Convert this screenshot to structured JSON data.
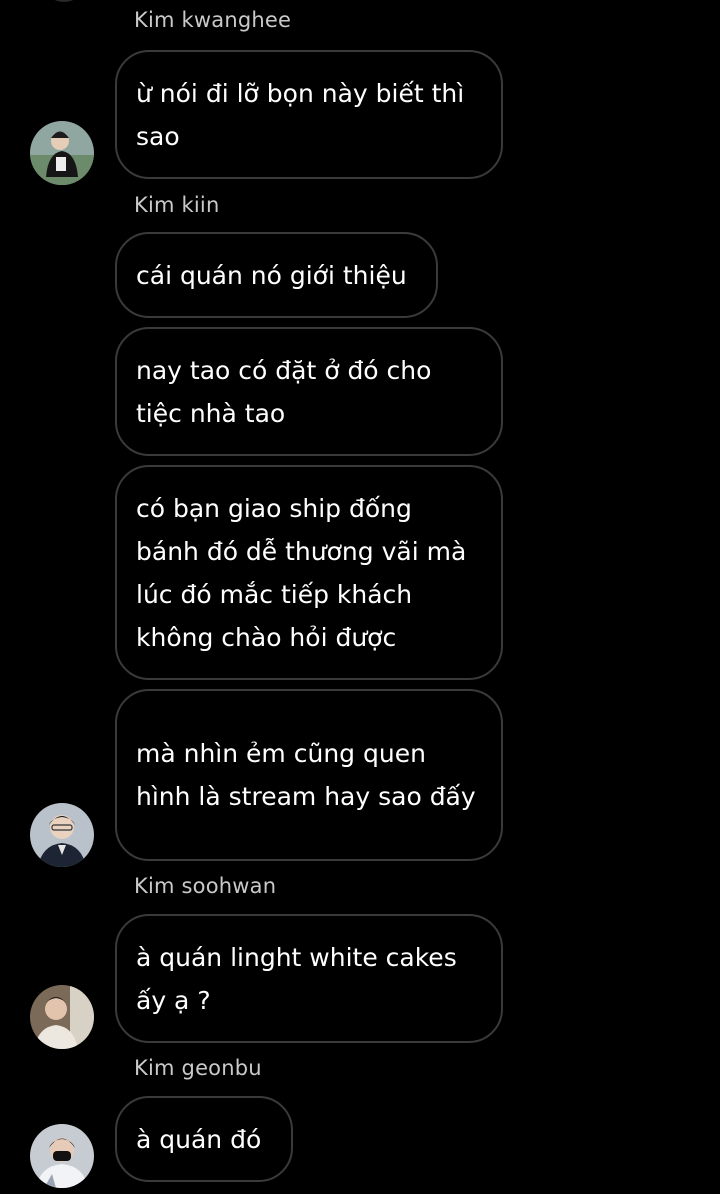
{
  "messages": [
    {
      "sender": "Kim kwanghee",
      "bubbles": [
        "ừ nói đi lỡ bọn này biết thì sao"
      ]
    },
    {
      "sender": "Kim kiin",
      "bubbles": [
        "cái quán nó giới thiệu",
        "nay tao có đặt ở đó cho tiệc nhà tao",
        "có bạn giao ship đống bánh đó dễ thương vãi mà lúc đó mắc tiếp khách không chào hỏi được",
        "mà nhìn ẻm cũng quen hình là stream hay sao đấy"
      ]
    },
    {
      "sender": "Kim soohwan",
      "bubbles": [
        "à quán linght white cakes ấy ạ ?"
      ]
    },
    {
      "sender": "Kim geonbu",
      "bubbles": [
        "à quán đó"
      ]
    }
  ],
  "avatars": [
    {
      "user": "Kim kwanghee",
      "icon": "user-avatar-icon"
    },
    {
      "user": "Kim kiin",
      "icon": "user-avatar-icon"
    },
    {
      "user": "Kim soohwan",
      "icon": "user-avatar-icon"
    },
    {
      "user": "Kim geonbu",
      "icon": "user-avatar-icon"
    }
  ],
  "colors": {
    "background": "#000000",
    "bubble_border": "#3a3a3a",
    "sender_name": "#c9c9c9",
    "message_text": "#ffffff"
  }
}
